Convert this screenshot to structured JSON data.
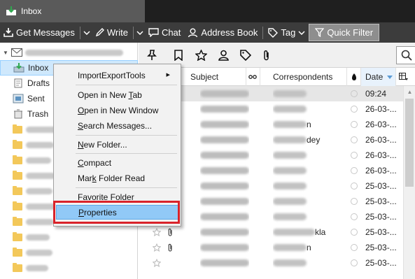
{
  "window": {
    "title": "Inbox"
  },
  "toolbar": {
    "get_messages": "Get Messages",
    "write": "Write",
    "chat": "Chat",
    "address_book": "Address Book",
    "tag": "Tag",
    "quick_filter": "Quick Filter"
  },
  "folders": {
    "inbox": "Inbox",
    "drafts": "Drafts",
    "sent": "Sent",
    "trash": "Trash"
  },
  "columns": {
    "subject": "Subject",
    "correspondents": "Correspondents",
    "date": "Date"
  },
  "messages": [
    {
      "correspondent": "",
      "date": "09:24"
    },
    {
      "correspondent": "",
      "date": "26-03-..."
    },
    {
      "correspondent": "n",
      "date": "26-03-..."
    },
    {
      "correspondent": "dey",
      "date": "26-03-..."
    },
    {
      "correspondent": "",
      "date": "26-03-..."
    },
    {
      "correspondent": "",
      "date": "26-03-..."
    },
    {
      "correspondent": "",
      "date": "25-03-..."
    },
    {
      "correspondent": "",
      "date": "25-03-..."
    },
    {
      "correspondent": "",
      "date": "25-03-..."
    },
    {
      "correspondent": "kla",
      "date": "25-03-..."
    },
    {
      "correspondent": "n",
      "date": "25-03-..."
    },
    {
      "correspondent": "",
      "date": "25-03-..."
    }
  ],
  "context_menu": {
    "import_export": "ImportExportTools",
    "open_new_tab_pre": "Open in New ",
    "open_new_tab_u": "T",
    "open_new_tab_post": "ab",
    "open_new_window_pre": "",
    "open_new_window_u": "O",
    "open_new_window_post": "pen in New Window",
    "search_pre": "",
    "search_u": "S",
    "search_post": "earch Messages...",
    "new_folder_pre": "",
    "new_folder_u": "N",
    "new_folder_post": "ew Folder...",
    "compact_pre": "",
    "compact_u": "C",
    "compact_post": "ompact",
    "mark_read_pre": "Mar",
    "mark_read_u": "k",
    "mark_read_post": " Folder Read",
    "favorite": "Favorite Folder",
    "properties_pre": "",
    "properties_u": "P",
    "properties_post": "roperties"
  },
  "colors": {
    "highlight": "#91c9f7",
    "annotation_red": "#d9232a",
    "toolbar_bg": "#3c3c3c"
  }
}
